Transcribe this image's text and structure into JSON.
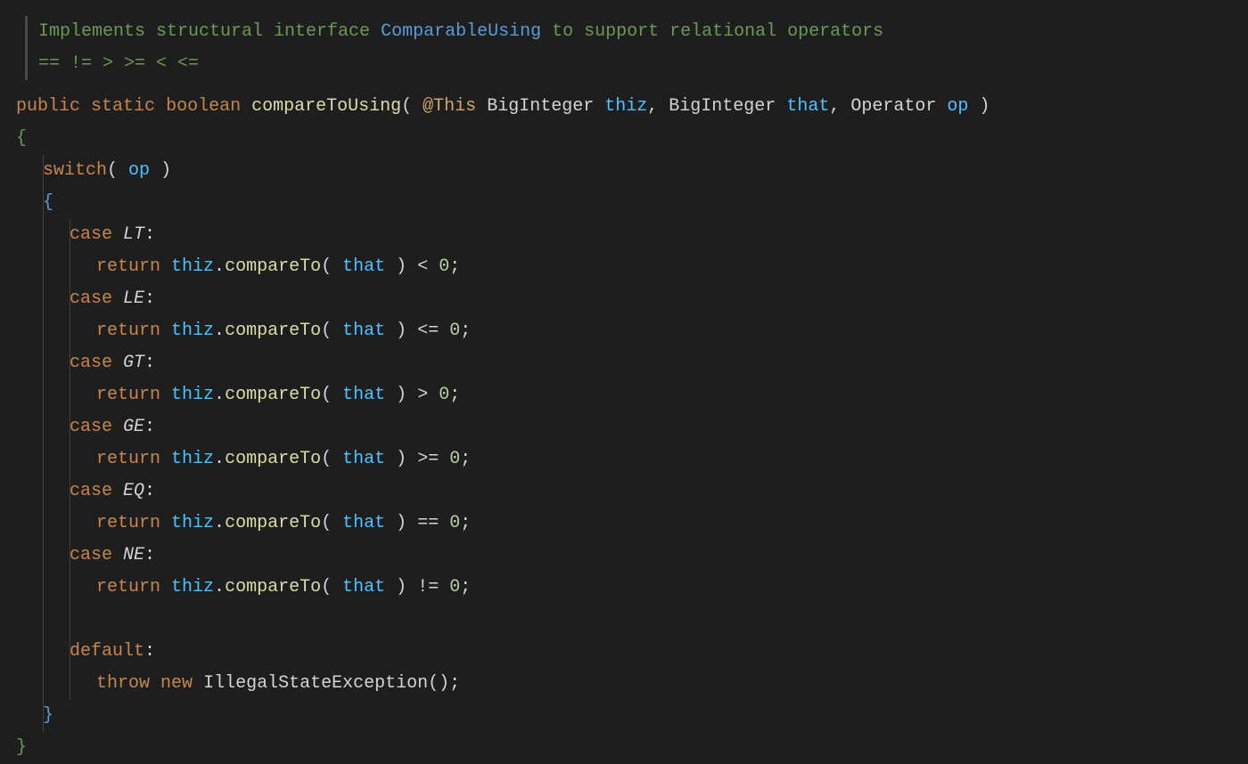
{
  "comment": {
    "line1_part1": "Implements structural interface ",
    "line1_link": "ComparableUsing",
    "line1_part2": " to support relational operators",
    "line2": "== != > >= < <="
  },
  "signature": {
    "public": "public",
    "static": "static",
    "boolean": "boolean",
    "method": "compareToUsing",
    "open_paren": "(",
    "annotation": "@This",
    "type1": "BigInteger",
    "param1": "thiz",
    "comma1": ",",
    "type2": "BigInteger",
    "param2": "that",
    "comma2": ",",
    "type3": "Operator",
    "param3": "op",
    "close_paren": ")"
  },
  "body": {
    "open_brace": "{",
    "switch": "switch",
    "switch_open": "(",
    "switch_var": "op",
    "switch_close": ")",
    "switch_brace": "{",
    "cases": [
      {
        "case": "case",
        "value": "LT",
        "colon": ":",
        "return": "return",
        "thiz": "thiz",
        "dot": ".",
        "method": "compareTo",
        "open": "(",
        "that": "that",
        "close": ")",
        "op": "<",
        "zero": "0",
        "semi": ";"
      },
      {
        "case": "case",
        "value": "LE",
        "colon": ":",
        "return": "return",
        "thiz": "thiz",
        "dot": ".",
        "method": "compareTo",
        "open": "(",
        "that": "that",
        "close": ")",
        "op": "<=",
        "zero": "0",
        "semi": ";"
      },
      {
        "case": "case",
        "value": "GT",
        "colon": ":",
        "return": "return",
        "thiz": "thiz",
        "dot": ".",
        "method": "compareTo",
        "open": "(",
        "that": "that",
        "close": ")",
        "op": ">",
        "zero": "0",
        "semi": ";"
      },
      {
        "case": "case",
        "value": "GE",
        "colon": ":",
        "return": "return",
        "thiz": "thiz",
        "dot": ".",
        "method": "compareTo",
        "open": "(",
        "that": "that",
        "close": ")",
        "op": ">=",
        "zero": "0",
        "semi": ";"
      },
      {
        "case": "case",
        "value": "EQ",
        "colon": ":",
        "return": "return",
        "thiz": "thiz",
        "dot": ".",
        "method": "compareTo",
        "open": "(",
        "that": "that",
        "close": ")",
        "op": "==",
        "zero": "0",
        "semi": ";"
      },
      {
        "case": "case",
        "value": "NE",
        "colon": ":",
        "return": "return",
        "thiz": "thiz",
        "dot": ".",
        "method": "compareTo",
        "open": "(",
        "that": "that",
        "close": ")",
        "op": "!=",
        "zero": "0",
        "semi": ";"
      }
    ],
    "default": "default",
    "default_colon": ":",
    "throw": "throw",
    "new": "new",
    "exception": "IllegalStateException",
    "exception_open": "(",
    "exception_close": ")",
    "exception_semi": ";",
    "switch_close_brace": "}",
    "close_brace": "}"
  }
}
